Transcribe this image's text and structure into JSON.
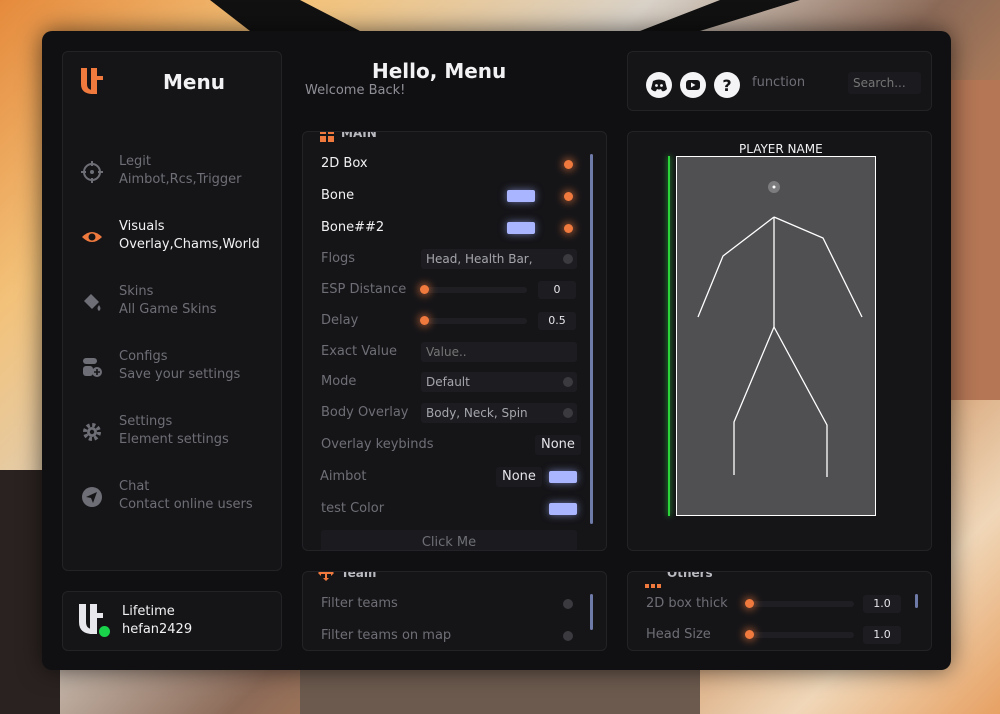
{
  "header": {
    "title": "Hello, Menu",
    "subtitle": "Welcome Back!"
  },
  "brand": {
    "title": "Menu"
  },
  "sidebar": {
    "items": [
      {
        "title": "Legit",
        "subtitle": "Aimbot,Rcs,Trigger",
        "icon": "crosshair-icon",
        "active": false
      },
      {
        "title": "Visuals",
        "subtitle": "Overlay,Chams,World",
        "icon": "eye-icon",
        "active": true
      },
      {
        "title": "Skins",
        "subtitle": "All Game Skins",
        "icon": "paint-bucket-icon",
        "active": false
      },
      {
        "title": "Configs",
        "subtitle": "Save your settings",
        "icon": "config-icon",
        "active": false
      },
      {
        "title": "Settings",
        "subtitle": "Element settings",
        "icon": "gear-icon",
        "active": false
      },
      {
        "title": "Chat",
        "subtitle": "Contact online users",
        "icon": "send-icon",
        "active": false
      }
    ]
  },
  "user": {
    "plan": "Lifetime",
    "name": "hefan2429",
    "status_color": "#19d34a"
  },
  "topbar": {
    "function_label": "function",
    "search_placeholder": "Search..."
  },
  "main": {
    "title": "MAIN",
    "rows": {
      "box2d": {
        "label": "2D Box"
      },
      "bone": {
        "label": "Bone"
      },
      "bone2": {
        "label": "Bone##2"
      },
      "flogs": {
        "label": "Flogs",
        "value": "Head, Health Bar, Play"
      },
      "esp": {
        "label": "ESP Distance",
        "value": "0",
        "fill": 0.0
      },
      "delay": {
        "label": "Delay",
        "value": "0.5",
        "fill": 0.0
      },
      "exact": {
        "label": "Exact Value",
        "placeholder": "Value.."
      },
      "mode": {
        "label": "Mode",
        "value": "Default"
      },
      "body_overlay": {
        "label": "Body Overlay",
        "value": "Body, Neck, Spin"
      },
      "overlay_kb": {
        "label": "Overlay keybinds",
        "value": "None"
      },
      "aimbot": {
        "label": "Aimbot",
        "value": "None"
      },
      "test_color": {
        "label": "test Color"
      },
      "click_me": {
        "label": "Click Me"
      }
    }
  },
  "preview": {
    "player_name": "PLAYER NAME"
  },
  "team": {
    "title": "Team",
    "rows": [
      {
        "label": "Filter teams"
      },
      {
        "label": "Filter teams on map"
      }
    ]
  },
  "others": {
    "title": "Others",
    "rows": [
      {
        "label": "2D box thick",
        "value": "1.0"
      },
      {
        "label": "Head Size",
        "value": "1.0"
      }
    ]
  },
  "colors": {
    "accent": "#f07a3e",
    "swatch": "#a9b5ff",
    "health_bar": "#2ad43a"
  }
}
